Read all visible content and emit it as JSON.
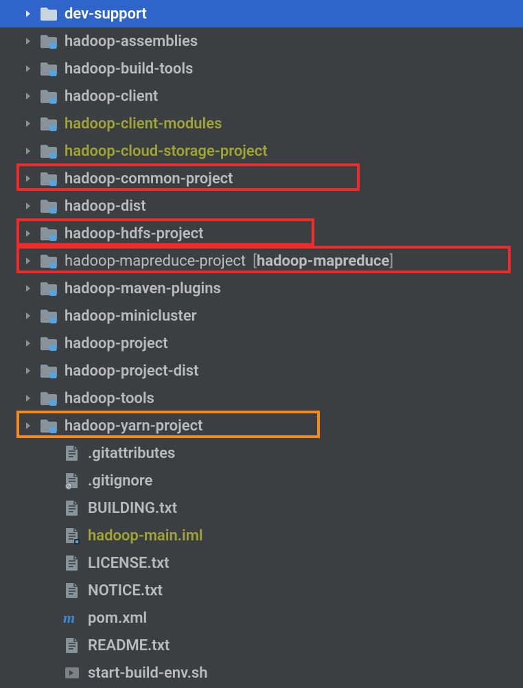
{
  "items": [
    {
      "label": "dev-support",
      "icon": "folder-plain",
      "selected": true,
      "expandable": true
    },
    {
      "label": "hadoop-assemblies",
      "icon": "folder-module",
      "expandable": true
    },
    {
      "label": "hadoop-build-tools",
      "icon": "folder-module",
      "expandable": true
    },
    {
      "label": "hadoop-client",
      "icon": "folder-module",
      "expandable": true
    },
    {
      "label": "hadoop-client-modules",
      "icon": "folder-module",
      "expandable": true,
      "accent": true
    },
    {
      "label": "hadoop-cloud-storage-project",
      "icon": "folder-module",
      "expandable": true,
      "accent": true
    },
    {
      "label": "hadoop-common-project",
      "icon": "folder-module",
      "expandable": true,
      "highlight": "red",
      "hlWidth": 500
    },
    {
      "label": "hadoop-dist",
      "icon": "folder-module",
      "expandable": true
    },
    {
      "label": "hadoop-hdfs-project",
      "icon": "folder-module",
      "expandable": true,
      "highlight": "red",
      "hlWidth": 434
    },
    {
      "label": "hadoop-mapreduce-project",
      "suffix": "hadoop-mapreduce",
      "icon": "folder-module",
      "expandable": true,
      "thin": true,
      "highlight": "red",
      "hlWidth": 720
    },
    {
      "label": "hadoop-maven-plugins",
      "icon": "folder-module",
      "expandable": true
    },
    {
      "label": "hadoop-minicluster",
      "icon": "folder-module",
      "expandable": true
    },
    {
      "label": "hadoop-project",
      "icon": "folder-module",
      "expandable": true
    },
    {
      "label": "hadoop-project-dist",
      "icon": "folder-module",
      "expandable": true
    },
    {
      "label": "hadoop-tools",
      "icon": "folder-module",
      "expandable": true
    },
    {
      "label": "hadoop-yarn-project",
      "icon": "folder-module",
      "expandable": true,
      "highlight": "orange",
      "hlWidth": 442
    },
    {
      "label": ".gitattributes",
      "icon": "file-text"
    },
    {
      "label": ".gitignore",
      "icon": "file-ignore"
    },
    {
      "label": "BUILDING.txt",
      "icon": "file-text"
    },
    {
      "label": "hadoop-main.iml",
      "icon": "file-iml",
      "accent": true
    },
    {
      "label": "LICENSE.txt",
      "icon": "file-text"
    },
    {
      "label": "NOTICE.txt",
      "icon": "file-text"
    },
    {
      "label": "pom.xml",
      "icon": "file-maven"
    },
    {
      "label": "README.txt",
      "icon": "file-text"
    },
    {
      "label": "start-build-env.sh",
      "icon": "file-runnable"
    }
  ]
}
